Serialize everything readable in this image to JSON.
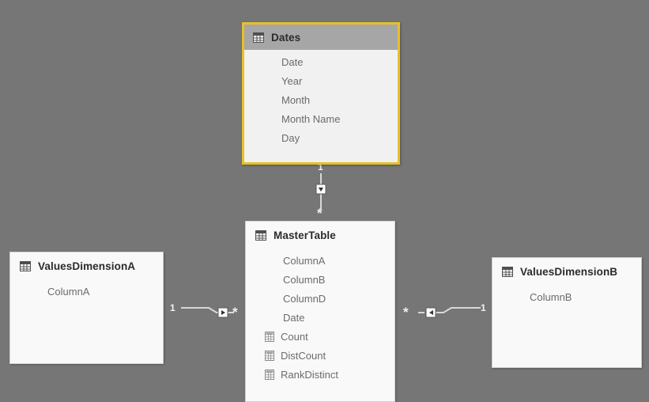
{
  "canvas": {
    "background_color": "#767676",
    "selected_border_color": "#e6c12a",
    "header_gray": "#a6a6a6",
    "card_background": "#f7f7f7"
  },
  "tables": [
    {
      "id": "dates",
      "name": "Dates",
      "icon": "table-icon",
      "selected": true,
      "fields": [
        {
          "name": "Date",
          "icon": null
        },
        {
          "name": "Year",
          "icon": null
        },
        {
          "name": "Month",
          "icon": null
        },
        {
          "name": "Month Name",
          "icon": null
        },
        {
          "name": "Day",
          "icon": null
        }
      ]
    },
    {
      "id": "mastertable",
      "name": "MasterTable",
      "icon": "table-icon",
      "selected": false,
      "fields": [
        {
          "name": "ColumnA",
          "icon": null
        },
        {
          "name": "ColumnB",
          "icon": null
        },
        {
          "name": "ColumnD",
          "icon": null
        },
        {
          "name": "Date",
          "icon": null
        },
        {
          "name": "Count",
          "icon": "measure-icon"
        },
        {
          "name": "DistCount",
          "icon": "measure-icon"
        },
        {
          "name": "RankDistinct",
          "icon": "measure-icon"
        }
      ]
    },
    {
      "id": "valuesdimensiona",
      "name": "ValuesDimensionA",
      "icon": "table-icon",
      "selected": false,
      "fields": [
        {
          "name": "ColumnA",
          "icon": null
        }
      ]
    },
    {
      "id": "valuesdimensionb",
      "name": "ValuesDimensionB",
      "icon": "table-icon",
      "selected": false,
      "fields": [
        {
          "name": "ColumnB",
          "icon": null
        }
      ]
    }
  ],
  "relationships": [
    {
      "id": "dates-to-mastertable",
      "from_table": "Dates",
      "to_table": "MasterTable",
      "from_cardinality": "1",
      "to_cardinality": "*",
      "cross_filter_direction": "down",
      "orientation": "vertical"
    },
    {
      "id": "valuesdimensiona-to-mastertable",
      "from_table": "ValuesDimensionA",
      "to_table": "MasterTable",
      "from_cardinality": "1",
      "to_cardinality": "*",
      "cross_filter_direction": "right",
      "orientation": "horizontal"
    },
    {
      "id": "mastertable-to-valuesdimensionb",
      "from_table": "MasterTable",
      "to_table": "ValuesDimensionB",
      "from_cardinality": "*",
      "to_cardinality": "1",
      "cross_filter_direction": "left",
      "orientation": "horizontal"
    }
  ]
}
